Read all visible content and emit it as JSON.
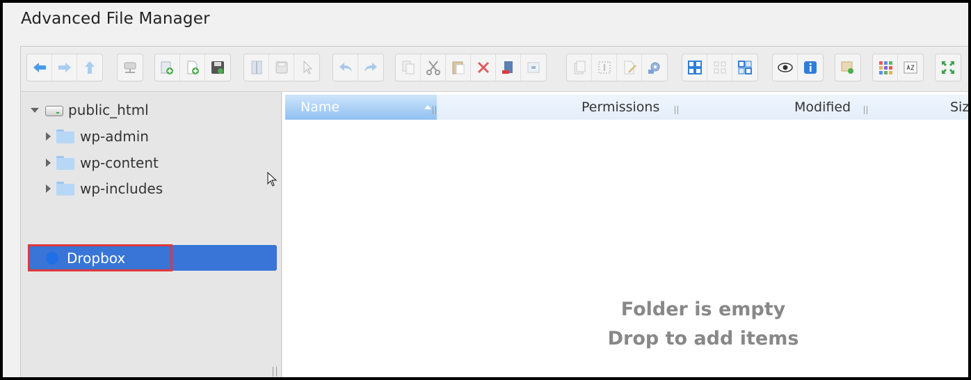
{
  "app": {
    "title": "Advanced File Manager"
  },
  "toolbar": {
    "groups": [
      [
        "back-icon",
        "forward-icon",
        "up-icon"
      ],
      [
        "network-drive-icon"
      ],
      [
        "new-folder-icon",
        "new-file-icon",
        "save-icon"
      ],
      [
        "open-icon",
        "save-disabled-icon",
        "select-icon"
      ],
      [
        "undo-icon",
        "redo-icon"
      ],
      [
        "copy-icon",
        "cut-icon",
        "paste-icon",
        "delete-icon",
        "rename-icon",
        "archive-icon"
      ],
      [
        "duplicate-icon",
        "select-area-icon",
        "edit-icon",
        "settings-icon"
      ],
      [
        "view-large-icon",
        "view-small-icon",
        "view-list-icon"
      ],
      [
        "preview-icon",
        "info-icon"
      ],
      [
        "extract-icon"
      ],
      [
        "grid-icon",
        "sort-az-icon"
      ],
      [
        "fullscreen-icon"
      ]
    ]
  },
  "tree": {
    "root": {
      "label": "public_html",
      "icon": "drive-icon",
      "expanded": true
    },
    "children": [
      {
        "label": "wp-admin",
        "icon": "folder-icon"
      },
      {
        "label": "wp-content",
        "icon": "folder-icon"
      },
      {
        "label": "wp-includes",
        "icon": "folder-icon"
      }
    ],
    "selected": {
      "label": "Dropbox",
      "icon": "dropbox-icon"
    }
  },
  "columns": {
    "name": "Name",
    "permissions": "Permissions",
    "modified": "Modified",
    "size": "Siz"
  },
  "content": {
    "empty_line1": "Folder is empty",
    "empty_line2": "Drop to add items"
  },
  "colors": {
    "selection": "#3875d7",
    "highlight_border": "#e0373d",
    "header_active": "#8fc1f1"
  }
}
